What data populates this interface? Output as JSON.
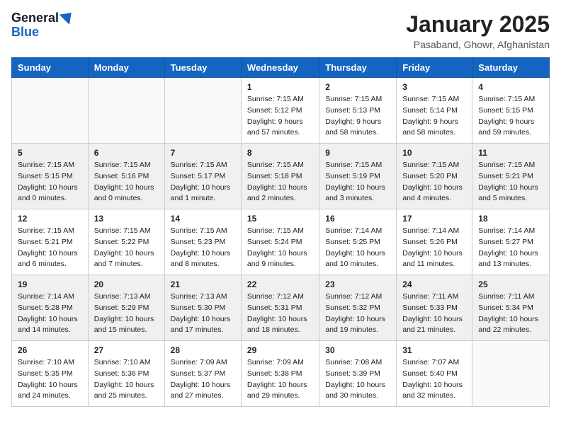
{
  "header": {
    "logo_general": "General",
    "logo_blue": "Blue",
    "title": "January 2025",
    "location": "Pasaband, Ghowr, Afghanistan"
  },
  "weekdays": [
    "Sunday",
    "Monday",
    "Tuesday",
    "Wednesday",
    "Thursday",
    "Friday",
    "Saturday"
  ],
  "weeks": [
    [
      {
        "day": "",
        "info": ""
      },
      {
        "day": "",
        "info": ""
      },
      {
        "day": "",
        "info": ""
      },
      {
        "day": "1",
        "info": "Sunrise: 7:15 AM\nSunset: 5:12 PM\nDaylight: 9 hours and 57 minutes."
      },
      {
        "day": "2",
        "info": "Sunrise: 7:15 AM\nSunset: 5:13 PM\nDaylight: 9 hours and 58 minutes."
      },
      {
        "day": "3",
        "info": "Sunrise: 7:15 AM\nSunset: 5:14 PM\nDaylight: 9 hours and 58 minutes."
      },
      {
        "day": "4",
        "info": "Sunrise: 7:15 AM\nSunset: 5:15 PM\nDaylight: 9 hours and 59 minutes."
      }
    ],
    [
      {
        "day": "5",
        "info": "Sunrise: 7:15 AM\nSunset: 5:15 PM\nDaylight: 10 hours and 0 minutes."
      },
      {
        "day": "6",
        "info": "Sunrise: 7:15 AM\nSunset: 5:16 PM\nDaylight: 10 hours and 0 minutes."
      },
      {
        "day": "7",
        "info": "Sunrise: 7:15 AM\nSunset: 5:17 PM\nDaylight: 10 hours and 1 minute."
      },
      {
        "day": "8",
        "info": "Sunrise: 7:15 AM\nSunset: 5:18 PM\nDaylight: 10 hours and 2 minutes."
      },
      {
        "day": "9",
        "info": "Sunrise: 7:15 AM\nSunset: 5:19 PM\nDaylight: 10 hours and 3 minutes."
      },
      {
        "day": "10",
        "info": "Sunrise: 7:15 AM\nSunset: 5:20 PM\nDaylight: 10 hours and 4 minutes."
      },
      {
        "day": "11",
        "info": "Sunrise: 7:15 AM\nSunset: 5:21 PM\nDaylight: 10 hours and 5 minutes."
      }
    ],
    [
      {
        "day": "12",
        "info": "Sunrise: 7:15 AM\nSunset: 5:21 PM\nDaylight: 10 hours and 6 minutes."
      },
      {
        "day": "13",
        "info": "Sunrise: 7:15 AM\nSunset: 5:22 PM\nDaylight: 10 hours and 7 minutes."
      },
      {
        "day": "14",
        "info": "Sunrise: 7:15 AM\nSunset: 5:23 PM\nDaylight: 10 hours and 8 minutes."
      },
      {
        "day": "15",
        "info": "Sunrise: 7:15 AM\nSunset: 5:24 PM\nDaylight: 10 hours and 9 minutes."
      },
      {
        "day": "16",
        "info": "Sunrise: 7:14 AM\nSunset: 5:25 PM\nDaylight: 10 hours and 10 minutes."
      },
      {
        "day": "17",
        "info": "Sunrise: 7:14 AM\nSunset: 5:26 PM\nDaylight: 10 hours and 11 minutes."
      },
      {
        "day": "18",
        "info": "Sunrise: 7:14 AM\nSunset: 5:27 PM\nDaylight: 10 hours and 13 minutes."
      }
    ],
    [
      {
        "day": "19",
        "info": "Sunrise: 7:14 AM\nSunset: 5:28 PM\nDaylight: 10 hours and 14 minutes."
      },
      {
        "day": "20",
        "info": "Sunrise: 7:13 AM\nSunset: 5:29 PM\nDaylight: 10 hours and 15 minutes."
      },
      {
        "day": "21",
        "info": "Sunrise: 7:13 AM\nSunset: 5:30 PM\nDaylight: 10 hours and 17 minutes."
      },
      {
        "day": "22",
        "info": "Sunrise: 7:12 AM\nSunset: 5:31 PM\nDaylight: 10 hours and 18 minutes."
      },
      {
        "day": "23",
        "info": "Sunrise: 7:12 AM\nSunset: 5:32 PM\nDaylight: 10 hours and 19 minutes."
      },
      {
        "day": "24",
        "info": "Sunrise: 7:11 AM\nSunset: 5:33 PM\nDaylight: 10 hours and 21 minutes."
      },
      {
        "day": "25",
        "info": "Sunrise: 7:11 AM\nSunset: 5:34 PM\nDaylight: 10 hours and 22 minutes."
      }
    ],
    [
      {
        "day": "26",
        "info": "Sunrise: 7:10 AM\nSunset: 5:35 PM\nDaylight: 10 hours and 24 minutes."
      },
      {
        "day": "27",
        "info": "Sunrise: 7:10 AM\nSunset: 5:36 PM\nDaylight: 10 hours and 25 minutes."
      },
      {
        "day": "28",
        "info": "Sunrise: 7:09 AM\nSunset: 5:37 PM\nDaylight: 10 hours and 27 minutes."
      },
      {
        "day": "29",
        "info": "Sunrise: 7:09 AM\nSunset: 5:38 PM\nDaylight: 10 hours and 29 minutes."
      },
      {
        "day": "30",
        "info": "Sunrise: 7:08 AM\nSunset: 5:39 PM\nDaylight: 10 hours and 30 minutes."
      },
      {
        "day": "31",
        "info": "Sunrise: 7:07 AM\nSunset: 5:40 PM\nDaylight: 10 hours and 32 minutes."
      },
      {
        "day": "",
        "info": ""
      }
    ]
  ]
}
